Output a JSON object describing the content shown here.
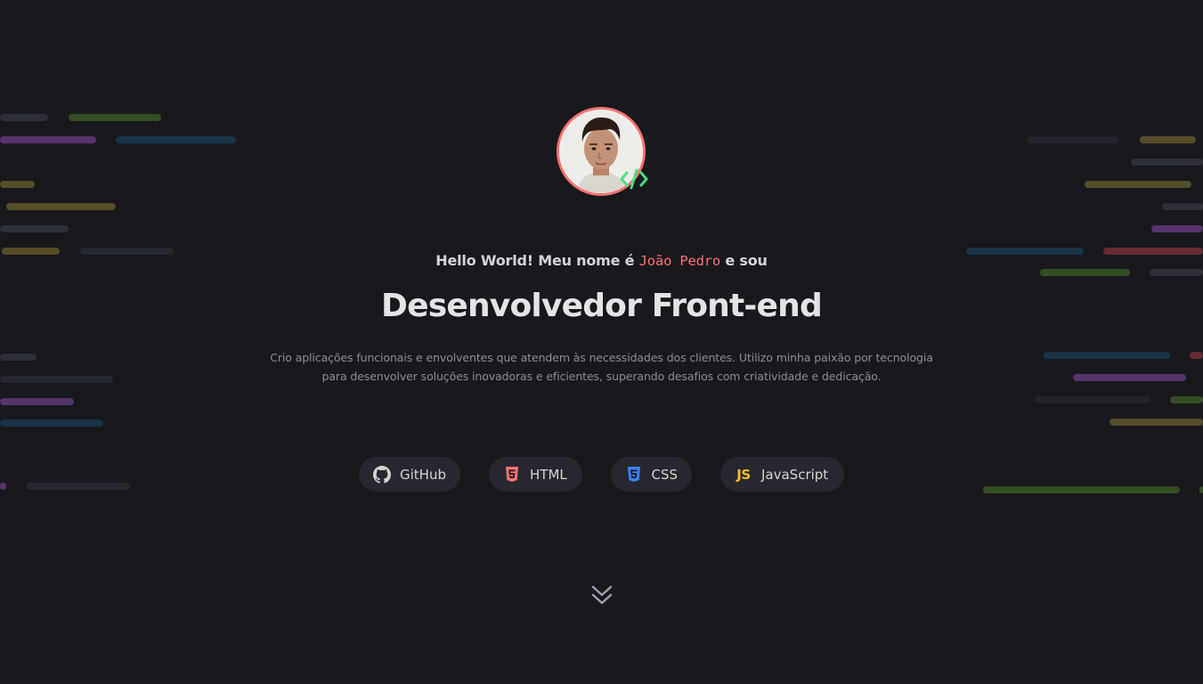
{
  "hero": {
    "greeting_prefix": "Hello World! Meu nome é ",
    "name": "João Pedro",
    "greeting_suffix": " e sou",
    "headline": "Desenvolvedor Front-end",
    "description": "Crio aplicações funcionais e envolventes que atendem às necessidades dos clientes. Utilizo minha paixão por tecnologia para desenvolver soluções inovadoras e eficientes, superando desafios com criatividade e dedicação."
  },
  "avatar": {
    "icon": "avatar-photo",
    "badge_icon": "code-icon",
    "border_color": "#f87171",
    "badge_color": "#22c55e"
  },
  "tech_pills": [
    {
      "label": "GitHub",
      "icon": "github-icon"
    },
    {
      "label": "HTML",
      "icon": "html5-icon",
      "color": "#f87171"
    },
    {
      "label": "CSS",
      "icon": "css3-icon",
      "color": "#3b82f6"
    },
    {
      "label": "JavaScript",
      "icon": "js-icon",
      "icon_text": "JS",
      "color": "#fbbf24"
    }
  ],
  "scroll": {
    "icon": "double-chevron-down-icon"
  },
  "colors": {
    "background": "#18181d",
    "accent": "#f87171",
    "pill_bg": "#27272f",
    "text_muted": "#8b8d98"
  }
}
